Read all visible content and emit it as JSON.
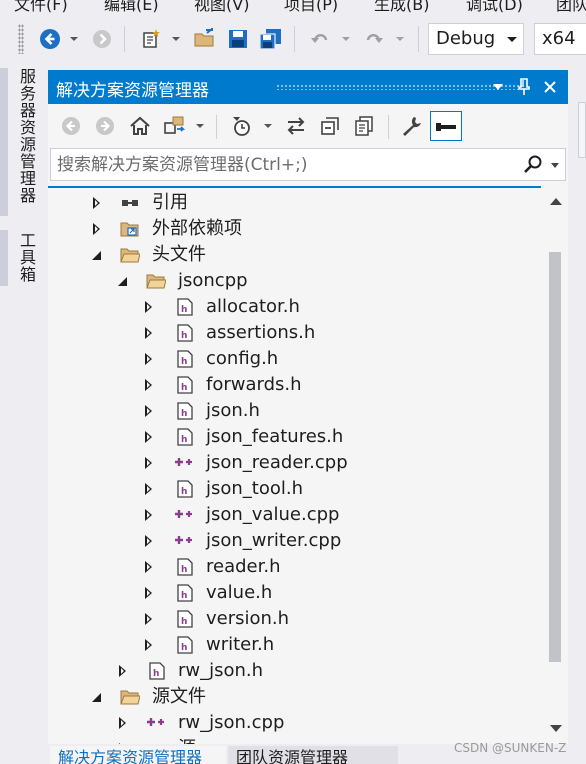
{
  "menu": {
    "items": [
      "文件(F)",
      "编辑(E)",
      "视图(V)",
      "项目(P)",
      "生成(B)",
      "调试(D)",
      "团队"
    ]
  },
  "toolbar": {
    "configuration": "Debug",
    "platform": "x64"
  },
  "side_tabs": [
    "服务器资源管理器",
    "工具箱"
  ],
  "panel": {
    "title": "解决方案资源管理器",
    "search_placeholder": "搜索解决方案资源管理器(Ctrl+;)"
  },
  "tree": [
    {
      "label": "引用",
      "level": 1,
      "state": "collapsed",
      "icon": "references-icon"
    },
    {
      "label": "外部依赖项",
      "level": 1,
      "state": "collapsed",
      "icon": "external-deps-icon"
    },
    {
      "label": "头文件",
      "level": 1,
      "state": "expanded",
      "icon": "folder-icon"
    },
    {
      "label": "jsoncpp",
      "level": 2,
      "state": "expanded",
      "icon": "folder-icon"
    },
    {
      "label": "allocator.h",
      "level": 3,
      "state": "collapsed",
      "icon": "header-file-icon"
    },
    {
      "label": "assertions.h",
      "level": 3,
      "state": "collapsed",
      "icon": "header-file-icon"
    },
    {
      "label": "config.h",
      "level": 3,
      "state": "collapsed",
      "icon": "header-file-icon"
    },
    {
      "label": "forwards.h",
      "level": 3,
      "state": "collapsed",
      "icon": "header-file-icon"
    },
    {
      "label": "json.h",
      "level": 3,
      "state": "collapsed",
      "icon": "header-file-icon"
    },
    {
      "label": "json_features.h",
      "level": 3,
      "state": "collapsed",
      "icon": "header-file-icon"
    },
    {
      "label": "json_reader.cpp",
      "level": 3,
      "state": "collapsed",
      "icon": "cpp-file-icon"
    },
    {
      "label": "json_tool.h",
      "level": 3,
      "state": "collapsed",
      "icon": "header-file-icon"
    },
    {
      "label": "json_value.cpp",
      "level": 3,
      "state": "collapsed",
      "icon": "cpp-file-icon"
    },
    {
      "label": "json_writer.cpp",
      "level": 3,
      "state": "collapsed",
      "icon": "cpp-file-icon"
    },
    {
      "label": "reader.h",
      "level": 3,
      "state": "collapsed",
      "icon": "header-file-icon"
    },
    {
      "label": "value.h",
      "level": 3,
      "state": "collapsed",
      "icon": "header-file-icon"
    },
    {
      "label": "version.h",
      "level": 3,
      "state": "collapsed",
      "icon": "header-file-icon"
    },
    {
      "label": "writer.h",
      "level": 3,
      "state": "collapsed",
      "icon": "header-file-icon"
    },
    {
      "label": "rw_json.h",
      "level": 2,
      "state": "collapsed",
      "icon": "header-file-icon"
    },
    {
      "label": "源文件",
      "level": 1,
      "state": "expanded",
      "icon": "folder-icon"
    },
    {
      "label": "rw_json.cpp",
      "level": 2,
      "state": "collapsed",
      "icon": "cpp-file-icon"
    },
    {
      "label": "源",
      "level": 2,
      "state": "collapsed",
      "icon": "cpp-file-icon"
    }
  ],
  "bottom_tabs": [
    {
      "label": "解决方案资源管理器",
      "active": true
    },
    {
      "label": "团队资源管理器",
      "active": false
    }
  ],
  "watermark": "CSDN @SUNKEN-Z",
  "colors": {
    "accent": "#007acc",
    "panel_bg": "#f5f5f5",
    "chrome_bg": "#eeeef2",
    "header_file": "#8a3c8f",
    "cpp_file": "#8a3c8f",
    "folder": "#dcb67a"
  }
}
